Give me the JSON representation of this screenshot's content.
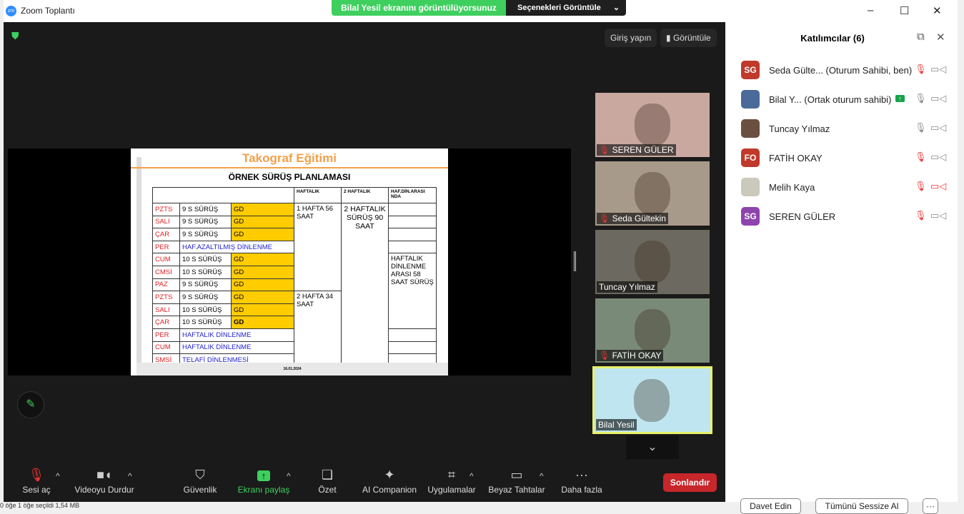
{
  "window": {
    "title": "Zoom Toplantı",
    "logo": "zm",
    "minimize": "–",
    "maximize": "☐",
    "close": "✕"
  },
  "banner": {
    "text": "Bilal Yesil ekranını görüntülüyorsunuz",
    "options": "Seçenekleri Görüntüle"
  },
  "topbar": {
    "signin": "Giriş yapın",
    "view": "Görüntüle"
  },
  "slide": {
    "title": "Takograf  Eğitimi",
    "subtitle": "ÖRNEK SÜRÜŞ  PLANLAMASI",
    "footer": "16.01.2024",
    "headers": [
      "HAFTALIK",
      "2 HAFTALIK",
      "HAF.DİN.ARASI NDA"
    ],
    "rows": [
      {
        "day": "PZTS",
        "act": "9 S SÜRÜŞ",
        "gd": "GD"
      },
      {
        "day": "SALI",
        "act": "9 S SÜRÜŞ",
        "gd": "GD"
      },
      {
        "day": "ÇAR",
        "act": "9 S SÜRÜŞ",
        "gd": "GD"
      },
      {
        "day": "PER",
        "act": "HAF.AZALTILMIŞ DİNLENME"
      },
      {
        "day": "CUM",
        "act": "10 S SÜRÜŞ",
        "gd": "GD"
      },
      {
        "day": "CMSİ",
        "act": "10 S SÜRÜŞ",
        "gd": "GD"
      },
      {
        "day": "PAZ",
        "act": "9 S SÜRÜŞ",
        "gd": "GD"
      },
      {
        "day": "PZTS",
        "act": "9 S SÜRÜŞ",
        "gd": "GD"
      },
      {
        "day": "SALI",
        "act": "10 S SÜRÜŞ",
        "gd": "GD"
      },
      {
        "day": "ÇAR",
        "act": "10 S SÜRÜŞ",
        "gd": "GD"
      },
      {
        "day": "PER",
        "act": "HAFTALIK DİNLENME"
      },
      {
        "day": "CUM",
        "act": "HAFTALIK DİNLENME"
      },
      {
        "day": "SMSİ",
        "act": "TELAFİ DİNLENMESİ"
      }
    ],
    "week1": "1 HAFTA 56 SAAT",
    "week2": "2 HAFTA 34 SAAT",
    "twoweek": "2 HAFTALIK SÜRÜŞ 90 SAAT",
    "between": "HAFTALIK DİNLENME ARASI 58 SAAT SÜRÜŞ"
  },
  "thumbs": [
    "SEREN GÜLER",
    "Seda Gültekin",
    "Tuncay Yılmaz",
    "FATİH OKAY",
    "Bilal Yesil"
  ],
  "panel": {
    "title": "Katılımcılar (6)",
    "participants": [
      {
        "initials": "SG",
        "color": "#c0392b",
        "name": "Seda Gülte...  (Oturum Sahibi, ben)",
        "mic": "muted",
        "video": "on"
      },
      {
        "initials": "",
        "color": "#4a6a9a",
        "name": "Bilal Y...  (Ortak oturum sahibi)",
        "mic": "on",
        "video": "on",
        "sharing": true
      },
      {
        "initials": "",
        "color": "#6b5040",
        "name": "Tuncay Yılmaz",
        "mic": "on",
        "video": "on"
      },
      {
        "initials": "FO",
        "color": "#c0392b",
        "name": "FATİH OKAY",
        "mic": "muted",
        "video": "on"
      },
      {
        "initials": "",
        "color": "#cbc8bc",
        "name": "Melih Kaya",
        "mic": "muted",
        "video": "off"
      },
      {
        "initials": "SG",
        "color": "#8e44ad",
        "name": "SEREN GÜLER",
        "mic": "muted",
        "video": "on"
      }
    ],
    "invite": "Davet Edin",
    "mute_all": "Tümünü Sessize Al",
    "more": "···"
  },
  "toolbar": {
    "unmute": "Sesi aç",
    "video": "Videoyu Durdur",
    "security": "Güvenlik",
    "share": "Ekranı paylaş",
    "summary": "Özet",
    "ai": "AI Companion",
    "apps": "Uygulamalar",
    "whiteboard": "Beyaz Tahtalar",
    "more": "Daha fazla",
    "end": "Sonlandır"
  },
  "status": "0 öğe     1 öğe seçildi  1,54 MB"
}
